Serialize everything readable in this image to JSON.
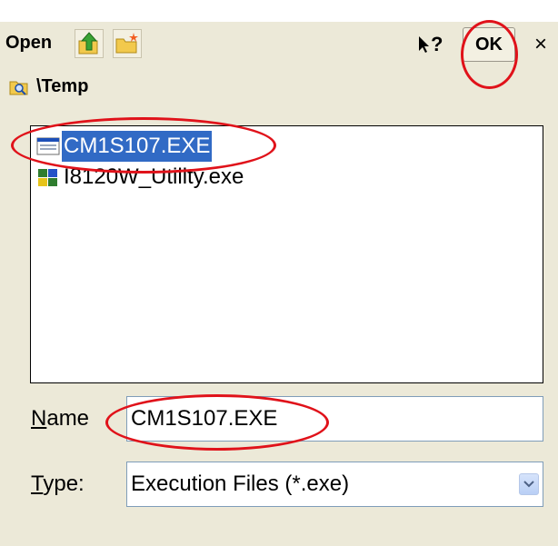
{
  "title": "Open",
  "toolbar": {
    "up_icon": "folder-up-icon",
    "new_folder_icon": "new-folder-icon",
    "help_label": "?",
    "ok_label": "OK",
    "close_label": "×"
  },
  "path": {
    "icon": "folder-search-icon",
    "text": "\\Temp"
  },
  "files": [
    {
      "name": "CM1S107.EXE",
      "icon": "exe-window-icon",
      "selected": true
    },
    {
      "name": "I8120W_Utility.exe",
      "icon": "app-puzzle-icon",
      "selected": false
    }
  ],
  "name_field": {
    "label_accel": "N",
    "label_rest": "ame",
    "value": "CM1S107.EXE"
  },
  "type_field": {
    "label_accel": "T",
    "label_rest": "ype:",
    "value": "Execution Files (*.exe)"
  },
  "colors": {
    "selection": "#316ac5",
    "annotation": "#e0121a",
    "dialog_bg": "#ece9d8"
  }
}
